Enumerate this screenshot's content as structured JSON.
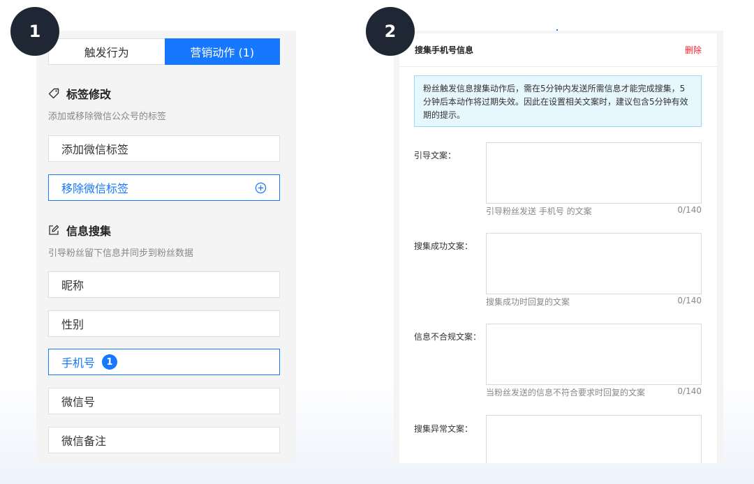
{
  "badges": {
    "step1": "1",
    "step2": "2"
  },
  "left": {
    "tabs": {
      "trigger": "触发行为",
      "action": "营销动作 (1)"
    },
    "tag_section": {
      "title": "标签修改",
      "desc": "添加或移除微信公众号的标签",
      "items": [
        "添加微信标签",
        "移除微信标签"
      ]
    },
    "info_section": {
      "title": "信息搜集",
      "desc": "引导粉丝留下信息并同步到粉丝数据",
      "items": [
        "昵称",
        "性别",
        "手机号",
        "微信号",
        "微信备注"
      ],
      "phone_count": "1"
    }
  },
  "right": {
    "title": "搜集手机号信息",
    "delete": "删除",
    "notice": "粉丝触发信息搜集动作后，需在5分钟内发送所需信息才能完成搜集，5分钟后本动作将过期失效。因此在设置相关文案时，建议包含5分钟有效期的提示。",
    "fields": [
      {
        "label": "引导文案：",
        "hint": "引导粉丝发送 手机号 的文案",
        "count": "0/140"
      },
      {
        "label": "搜集成功文案：",
        "hint": "搜集成功时回复的文案",
        "count": "0/140"
      },
      {
        "label": "信息不合规文案：",
        "hint": "当粉丝发送的信息不符合要求时回复的文案",
        "count": "0/140"
      },
      {
        "label": "搜集异常文案："
      }
    ]
  },
  "colors": {
    "accent": "#1677ff",
    "danger": "#f5222d",
    "dark": "#1e2733"
  }
}
